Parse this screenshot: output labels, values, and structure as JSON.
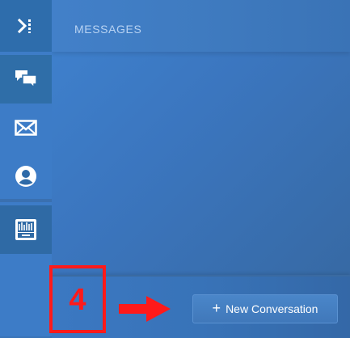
{
  "header": {
    "title": "MESSAGES"
  },
  "sidebar": {
    "items": [
      {
        "name": "sidebar-toggle",
        "icon": "collapse-arrow-icon"
      },
      {
        "name": "conversations",
        "icon": "chat-bubbles-icon"
      },
      {
        "name": "mail",
        "icon": "envelope-icon"
      },
      {
        "name": "profile",
        "icon": "user-icon"
      },
      {
        "name": "tickets",
        "icon": "inbox-tray-icon"
      }
    ]
  },
  "footer": {
    "new_conversation_label": "New Conversation",
    "new_conversation_icon": "+"
  },
  "annotation": {
    "step_number": "4",
    "color": "#ff1a1a"
  },
  "colors": {
    "panel": "#3b76bf",
    "sidebar": "#3d7cc7",
    "sidebar_active": "#2f6ea8"
  }
}
